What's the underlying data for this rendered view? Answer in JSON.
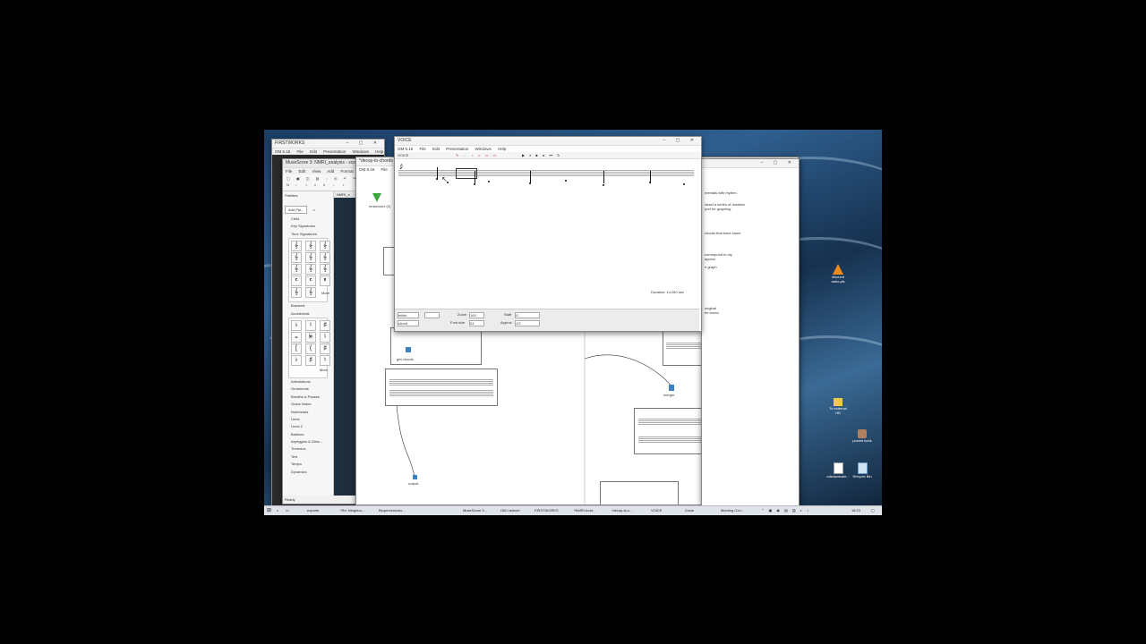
{
  "main_window": {
    "title": "VOICE",
    "app_name": "OM 6.16",
    "menu": [
      "OM 6.16",
      "File",
      "Edit",
      "Presentation",
      "Windows",
      "Help"
    ],
    "toolbar_label": "VOICE",
    "duration_label": "Duration: 14.260 sec",
    "controls": {
      "mode_value": "midic",
      "mode2_value": "chord",
      "zoom_label": "Zoom",
      "zoom_value": "100",
      "fontsize_label": "Font size",
      "fontsize_value": "24",
      "staff_label": "Staff",
      "staff_value": "G",
      "approx_label": "Approx",
      "approx_value": "1/2"
    }
  },
  "om_window": {
    "title": "FIRSTWORKS",
    "menu": [
      "OM 6.16",
      "File",
      "Edit",
      "Presentation",
      "Windows",
      "Help"
    ]
  },
  "musescore": {
    "title": "MuseScore 3: NMRI_analysis - score",
    "menu": [
      "File",
      "Edit",
      "View",
      "Add",
      "Format",
      "Tools"
    ],
    "tab": "NMRI_a",
    "palettes_title": "Palettes",
    "add_palette": "Add Pal...",
    "palette_sections_top": [
      "Clefs",
      "Key Signatures",
      "Time Signatures"
    ],
    "more": "More",
    "palette_sections_mid": [
      "Brackets",
      "Accidentals"
    ],
    "palette_sections_bottom": [
      "Articulations",
      "Ornaments",
      "Breaths & Pauses",
      "Grace Notes",
      "Noteheads",
      "Lines",
      "Lines 2",
      "Barlines",
      "Arpeggios & Gliss...",
      "Tremolos",
      "Text",
      "Tempo",
      "Dynamics"
    ],
    "status": "Ready"
  },
  "patch_window": {
    "title": "*decay-to-chords",
    "menu": [
      "OM 6.16",
      "File",
      "Edit"
    ],
    "boxes": {
      "museconv": "museconv (2)",
      "get_chords": "get-chords",
      "output": "output",
      "merger": "merger"
    }
  },
  "notes_window": {
    "lines": [
      "mentals with rhythm.",
      "xtract a series of duration",
      "port for graphing",
      "chords that have same",
      "correspond to my",
      "approx",
      "e graph",
      "original",
      "be found"
    ]
  },
  "desktop_icons": [
    {
      "label": "sfsound radio.pls"
    },
    {
      "label": "To external HD"
    },
    {
      "label": "pocket kunk"
    },
    {
      "label": "cdsdocscale..."
    },
    {
      "label": "Recycle Bin"
    }
  ],
  "left_desktop_icons": [
    {
      "label": "Blender"
    },
    {
      "label": "Adobe Lightroom"
    },
    {
      "label": "OBS Studio"
    }
  ],
  "taskbar": {
    "items": [
      "exports",
      "*Re: Neighbo...",
      "Bluperesmusic...",
      "MuseScore 3...",
      "OM Listener",
      "FIRSTWORKS",
      "*NMRI-fund...",
      "*decay-to-c...",
      "VOICE",
      "Zoom",
      "Meeting Con..."
    ],
    "clock": "18:23"
  }
}
